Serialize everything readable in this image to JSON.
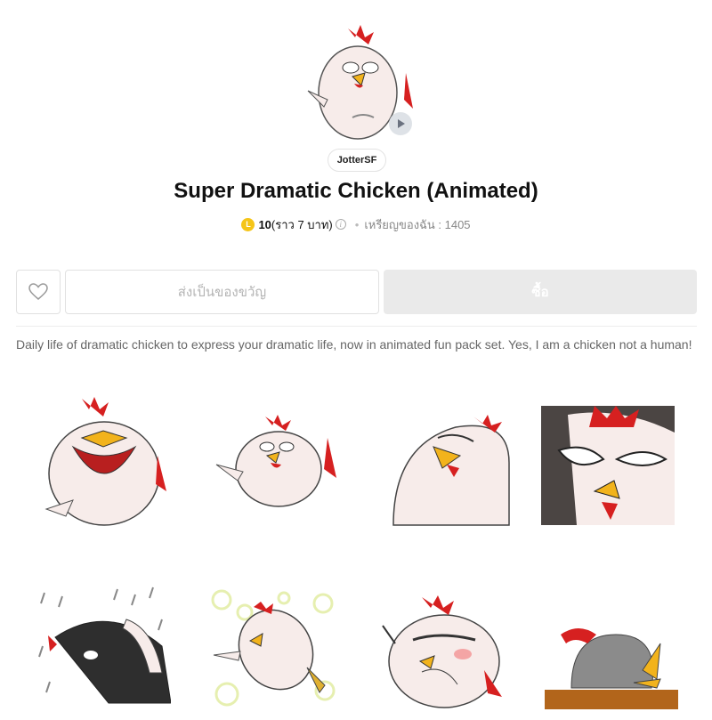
{
  "pack": {
    "author": "JotterSF",
    "title": "Super Dramatic Chicken (Animated)",
    "price_coins": "10",
    "price_approx": "(ราว 7 บาท)",
    "my_coins": "เหรียญของฉัน : 1405",
    "description": "Daily life of dramatic chicken to express your dramatic life, now in animated fun pack set. Yes, I am a chicken not a human!"
  },
  "actions": {
    "gift_label": "ส่งเป็นของขวัญ",
    "buy_label": "ซื้อ"
  },
  "icons": {
    "coin": "coin-icon",
    "info": "info-icon",
    "favorite": "heart-icon",
    "play": "play-icon"
  },
  "colors": {
    "coin": "#f5c518",
    "buy_button_bg": "#eaeaea",
    "description_text": "#666666",
    "chicken_comb": "#d62020",
    "chicken_beak": "#f2b31c"
  },
  "stickers": [
    {
      "name": "sticker-crying-laugh"
    },
    {
      "name": "sticker-pointing-tongue"
    },
    {
      "name": "sticker-side-glare"
    },
    {
      "name": "sticker-closeup-eyes"
    },
    {
      "name": "sticker-rain-gloom"
    },
    {
      "name": "sticker-falling-bubbles"
    },
    {
      "name": "sticker-blushing-covering"
    },
    {
      "name": "sticker-head-down"
    }
  ]
}
